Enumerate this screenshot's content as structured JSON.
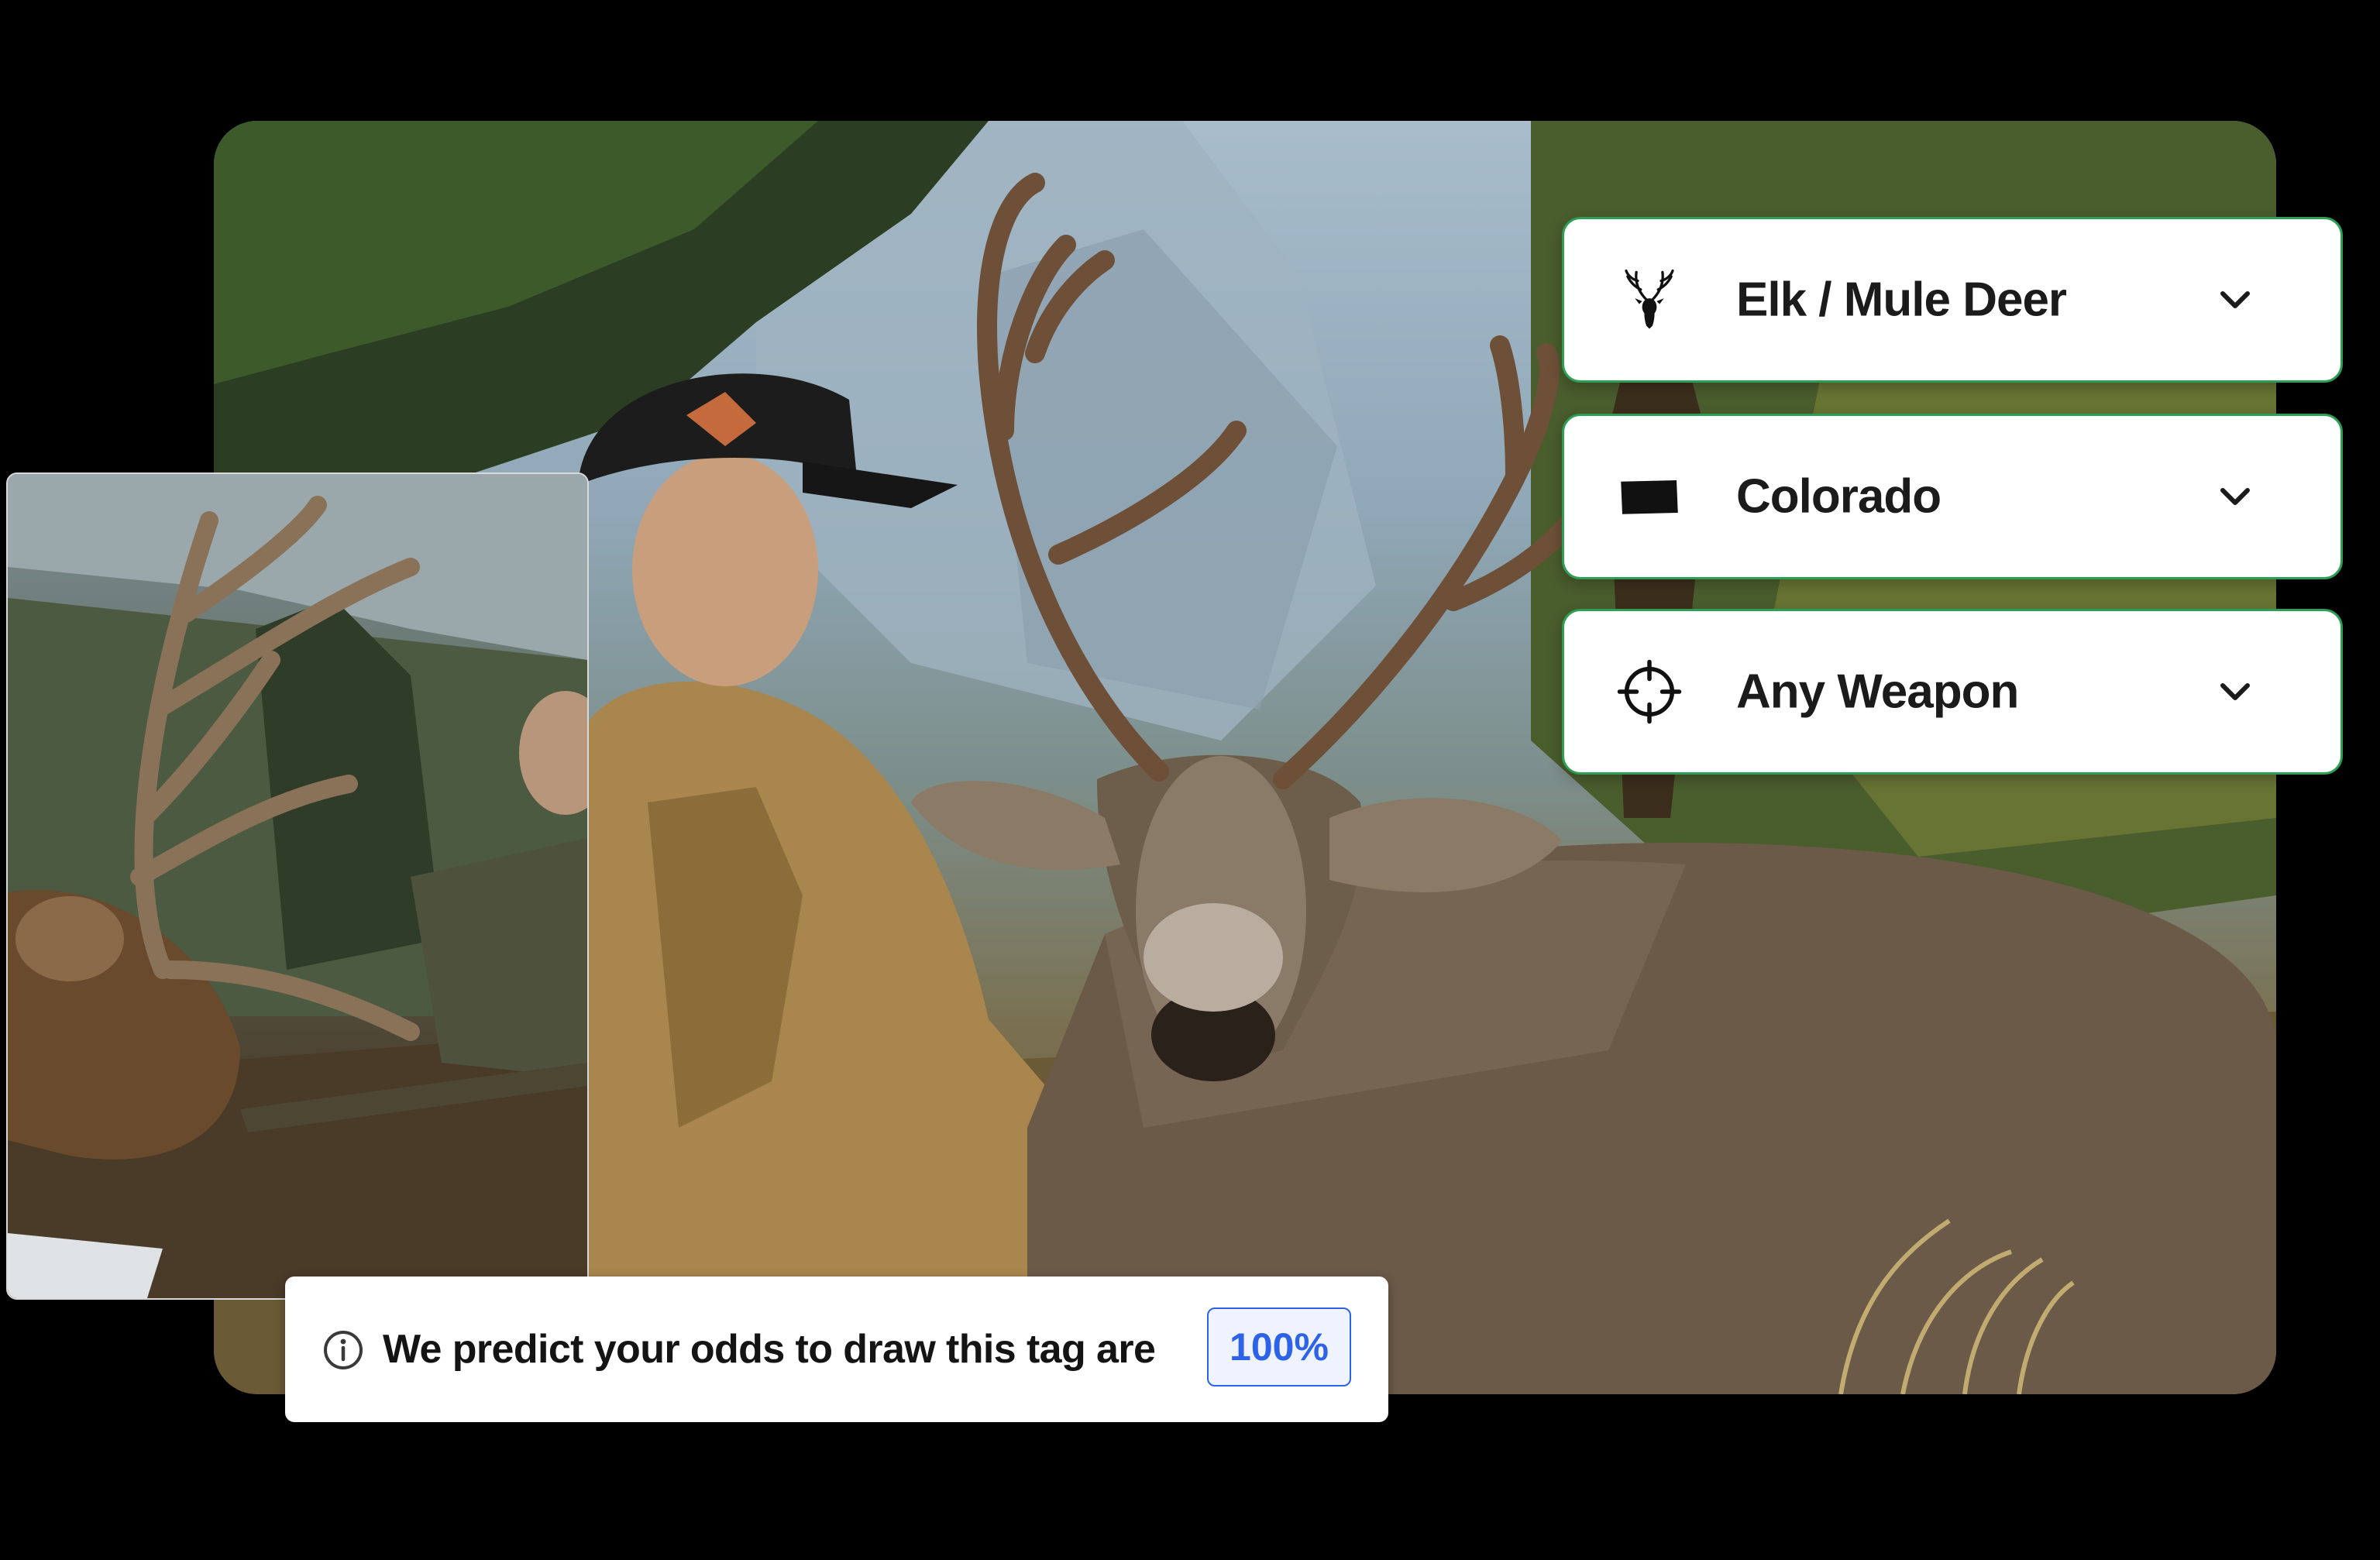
{
  "selectors": {
    "species": {
      "label": "Elk / Mule Deer",
      "icon": "deer-head-icon"
    },
    "state": {
      "label": "Colorado",
      "icon": "colorado-state-icon"
    },
    "weapon": {
      "label": "Any Weapon",
      "icon": "crosshair-icon"
    }
  },
  "odds": {
    "message": "We predict your odds to draw this tag are",
    "value": "100%",
    "icon": "info-icon"
  },
  "colors": {
    "selector_border": "#2e9e54",
    "odds_accent": "#2c63e8",
    "background": "#000000"
  },
  "images": {
    "hero": "hunter-with-mule-deer-photo",
    "inset": "hunter-with-elk-photo"
  }
}
